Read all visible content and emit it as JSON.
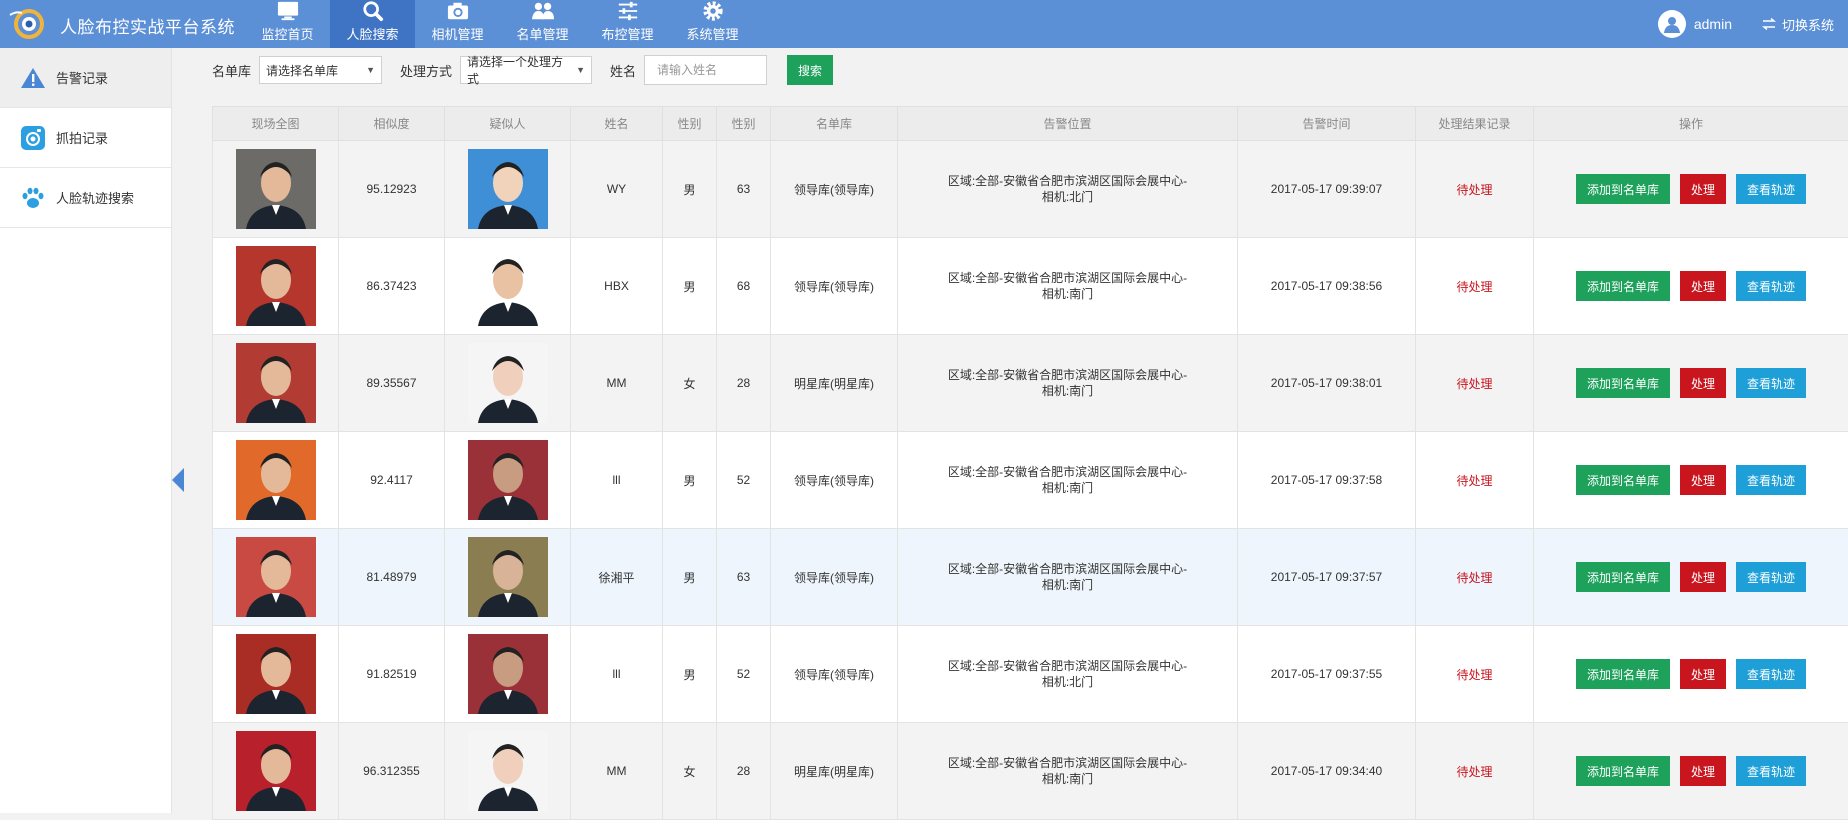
{
  "app": {
    "title": "人脸布控实战平台系统"
  },
  "nav": [
    {
      "label": "监控首页",
      "icon": "monitor-icon",
      "active": false
    },
    {
      "label": "人脸搜索",
      "icon": "search-icon",
      "active": true
    },
    {
      "label": "相机管理",
      "icon": "camera-icon",
      "active": false
    },
    {
      "label": "名单管理",
      "icon": "users-icon",
      "active": false
    },
    {
      "label": "布控管理",
      "icon": "sliders-icon",
      "active": false
    },
    {
      "label": "系统管理",
      "icon": "gear-icon",
      "active": false
    }
  ],
  "user": {
    "name": "admin",
    "switch_label": "切换系统"
  },
  "sidebar": {
    "items": [
      {
        "label": "告警记录",
        "icon": "warning-icon",
        "active": true
      },
      {
        "label": "抓拍记录",
        "icon": "snapshot-icon",
        "active": false
      },
      {
        "label": "人脸轨迹搜索",
        "icon": "paw-icon",
        "active": false
      }
    ]
  },
  "filters": {
    "list_label": "名单库",
    "list_select": "请选择名单库",
    "method_label": "处理方式",
    "method_select": "请选择一个处理方式",
    "name_label": "姓名",
    "name_placeholder": "请输入姓名",
    "search_label": "搜索"
  },
  "table": {
    "headers": [
      "现场全图",
      "相似度",
      "疑似人",
      "姓名",
      "性别",
      "性别",
      "名单库",
      "告警位置",
      "告警时间",
      "处理结果记录",
      "操作"
    ],
    "buttons": {
      "add": "添加到名单库",
      "process": "处理",
      "track": "查看轨迹"
    },
    "rows": [
      {
        "similarity": "95.12923",
        "name": "WY",
        "gender": "男",
        "age": "63",
        "list": "领导库(领导库)",
        "loc1": "区域:全部-安徽省合肥市滨湖区国际会展中心-",
        "loc2": "相机:北门",
        "time": "2017-05-17 09:39:07",
        "status": "待处理"
      },
      {
        "similarity": "86.37423",
        "name": "HBX",
        "gender": "男",
        "age": "68",
        "list": "领导库(领导库)",
        "loc1": "区域:全部-安徽省合肥市滨湖区国际会展中心-",
        "loc2": "相机:南门",
        "time": "2017-05-17 09:38:56",
        "status": "待处理"
      },
      {
        "similarity": "89.35567",
        "name": "MM",
        "gender": "女",
        "age": "28",
        "list": "明星库(明星库)",
        "loc1": "区域:全部-安徽省合肥市滨湖区国际会展中心-",
        "loc2": "相机:南门",
        "time": "2017-05-17 09:38:01",
        "status": "待处理"
      },
      {
        "similarity": "92.4117",
        "name": "lll",
        "gender": "男",
        "age": "52",
        "list": "领导库(领导库)",
        "loc1": "区域:全部-安徽省合肥市滨湖区国际会展中心-",
        "loc2": "相机:南门",
        "time": "2017-05-17 09:37:58",
        "status": "待处理"
      },
      {
        "similarity": "81.48979",
        "name": "徐湘平",
        "gender": "男",
        "age": "63",
        "list": "领导库(领导库)",
        "loc1": "区域:全部-安徽省合肥市滨湖区国际会展中心-",
        "loc2": "相机:南门",
        "time": "2017-05-17 09:37:57",
        "status": "待处理"
      },
      {
        "similarity": "91.82519",
        "name": "lll",
        "gender": "男",
        "age": "52",
        "list": "领导库(领导库)",
        "loc1": "区域:全部-安徽省合肥市滨湖区国际会展中心-",
        "loc2": "相机:北门",
        "time": "2017-05-17 09:37:55",
        "status": "待处理"
      },
      {
        "similarity": "96.312355",
        "name": "MM",
        "gender": "女",
        "age": "28",
        "list": "明星库(明星库)",
        "loc1": "区域:全部-安徽省合肥市滨湖区国际会展中心-",
        "loc2": "相机:南门",
        "time": "2017-05-17 09:34:40",
        "status": "待处理"
      }
    ]
  },
  "colors": {
    "header": "#5b8fd6",
    "nav_active": "#3f74c4",
    "green": "#1da15b",
    "red": "#c9151e",
    "blue": "#1e9fd8"
  }
}
